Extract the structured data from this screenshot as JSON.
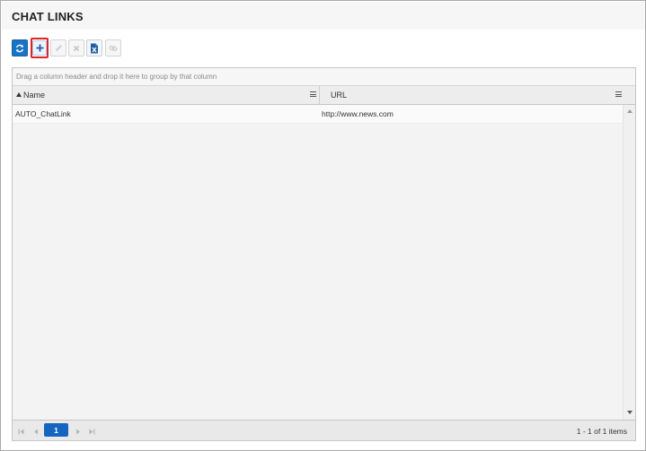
{
  "page": {
    "title": "CHAT LINKS"
  },
  "toolbar": {
    "buttons": [
      {
        "id": "refresh",
        "icon": "refresh-icon",
        "enabled": true
      },
      {
        "id": "add",
        "icon": "plus-icon",
        "enabled": true,
        "highlighted": true
      },
      {
        "id": "edit",
        "icon": "pencil-icon",
        "enabled": false
      },
      {
        "id": "delete",
        "icon": "close-icon",
        "enabled": false
      },
      {
        "id": "export",
        "icon": "excel-export-icon",
        "enabled": true
      },
      {
        "id": "link",
        "icon": "link-icon",
        "enabled": false
      }
    ]
  },
  "grid": {
    "group_hint": "Drag a column header and drop it here to group by that column",
    "columns": [
      {
        "label": "Name",
        "sort": "ascending"
      },
      {
        "label": "URL"
      }
    ],
    "rows": [
      {
        "name": "AUTO_ChatLink",
        "url": "http://www.news.com"
      }
    ]
  },
  "pager": {
    "current_page": "1",
    "info": "1 - 1 of 1 items"
  },
  "colors": {
    "accent": "#1a73c4",
    "highlight_border": "#d9262c"
  }
}
